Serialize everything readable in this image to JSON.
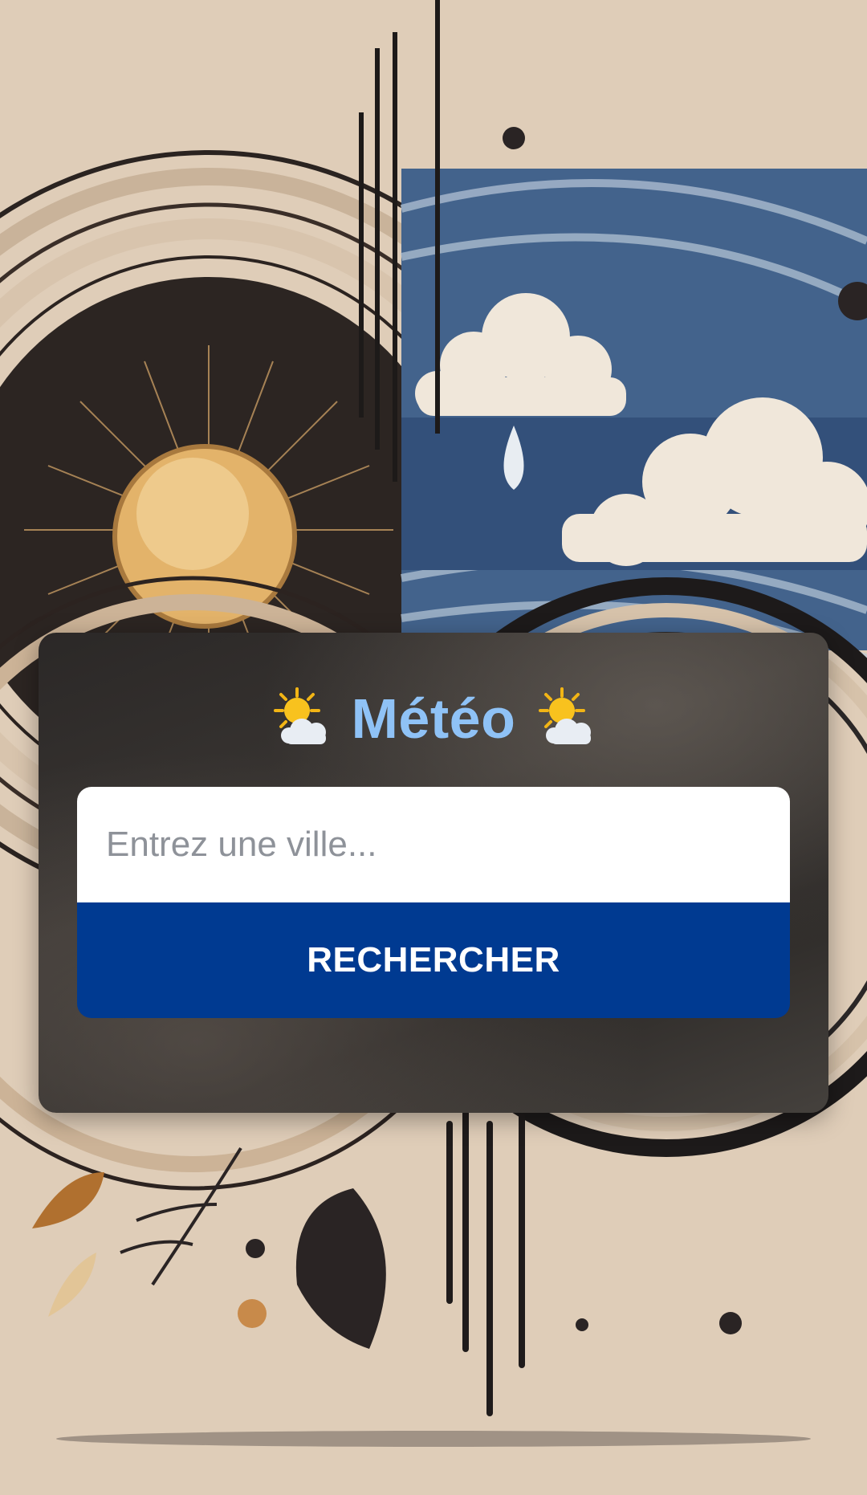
{
  "app": {
    "title": "Météo",
    "title_icon": "sun-behind-cloud-icon"
  },
  "search": {
    "placeholder": "Entrez une ville...",
    "value": "",
    "button_label": "RECHERCHER"
  },
  "colors": {
    "title": "#8fc2f6",
    "button": "#003a91",
    "card": "#2e2b29",
    "background": "#dfcdb8"
  }
}
